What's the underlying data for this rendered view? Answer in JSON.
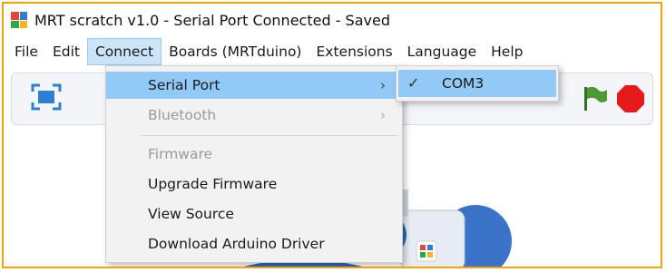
{
  "window": {
    "title": "MRT scratch v1.0 - Serial Port Connected - Saved",
    "icon": "app-logo-icon"
  },
  "menubar": {
    "items": [
      {
        "label": "File"
      },
      {
        "label": "Edit"
      },
      {
        "label": "Connect",
        "active": true
      },
      {
        "label": "Boards (MRTduino)"
      },
      {
        "label": "Extensions"
      },
      {
        "label": "Language"
      },
      {
        "label": "Help"
      }
    ]
  },
  "connect_menu": {
    "items": [
      {
        "label": "Serial Port",
        "has_submenu": true,
        "highlighted": true,
        "enabled": true
      },
      {
        "label": "Bluetooth",
        "has_submenu": true,
        "enabled": false
      },
      {
        "label": "Firmware",
        "enabled": false
      },
      {
        "label": "Upgrade Firmware",
        "enabled": true
      },
      {
        "label": "View Source",
        "enabled": true
      },
      {
        "label": "Download Arduino Driver",
        "enabled": true
      }
    ],
    "submenu_arrow": "›"
  },
  "serial_port_submenu": {
    "items": [
      {
        "label": "COM3",
        "checked": true,
        "check_glyph": "✓"
      }
    ]
  },
  "toolbar": {
    "icons": [
      "fullscreen-icon",
      "green-flag-icon",
      "stop-sign-icon"
    ]
  },
  "colors": {
    "frame_border": "#f0a30a",
    "menu_highlight": "#91c9f7",
    "active_menubar": "#cce4f7",
    "flag": "#3d8a2a",
    "stop": "#e51b1b"
  }
}
